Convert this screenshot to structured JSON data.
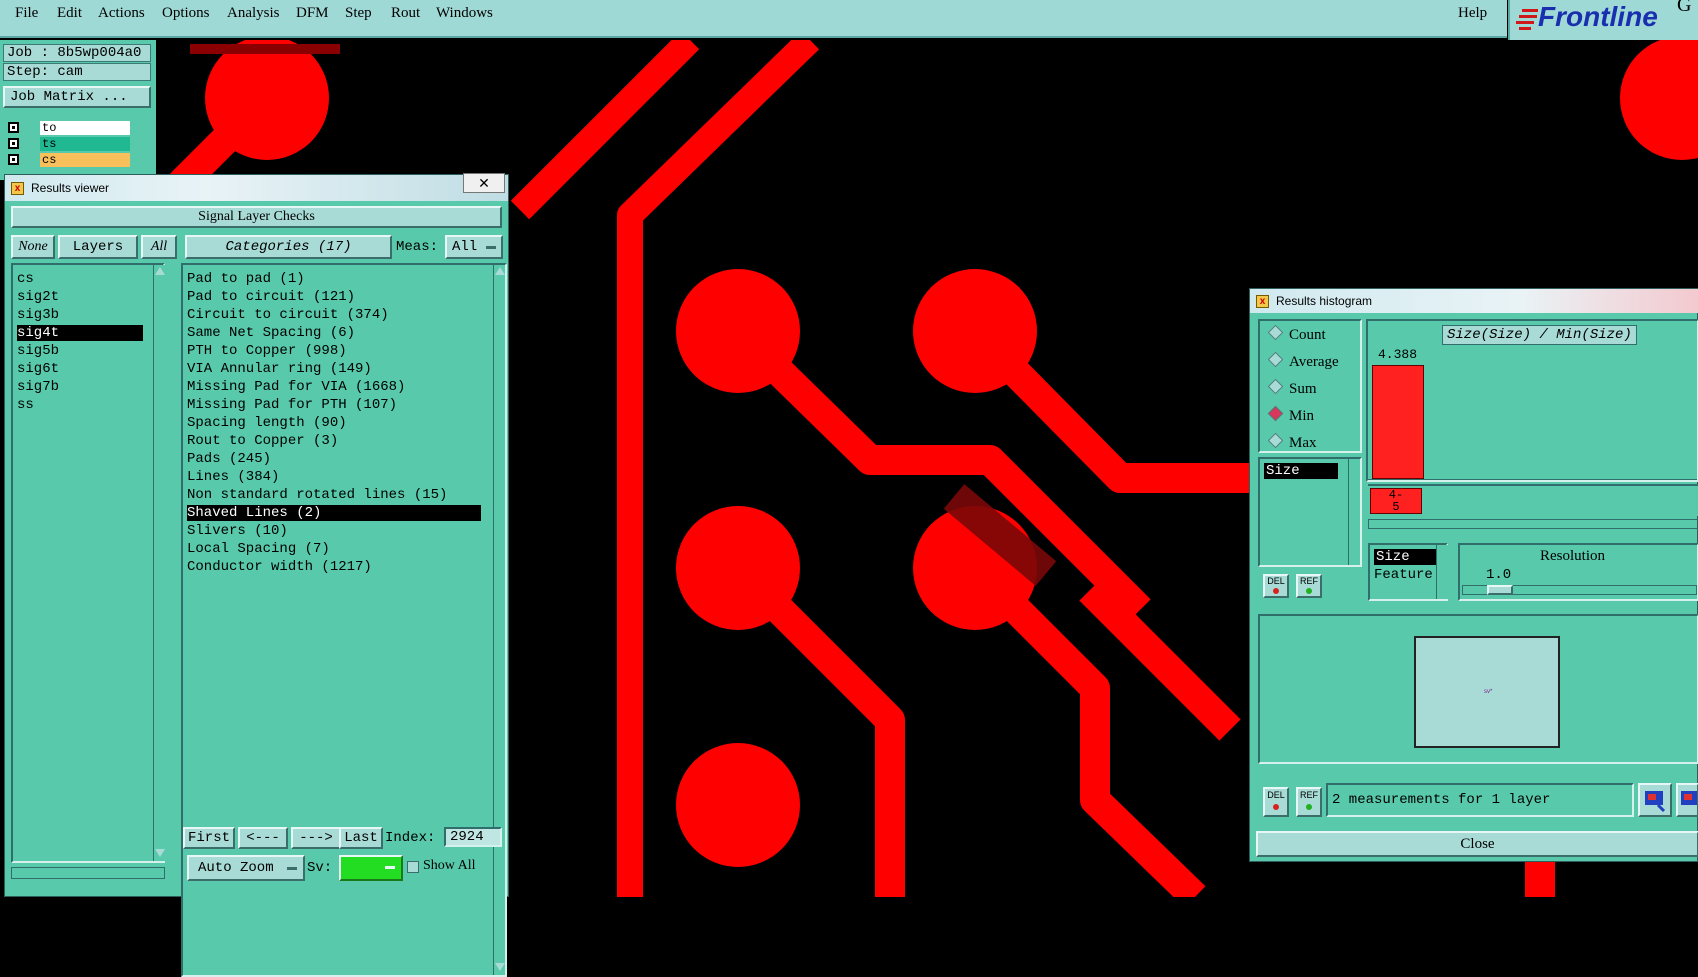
{
  "menubar": {
    "items": [
      "File",
      "Edit",
      "Actions",
      "Options",
      "Analysis",
      "DFM",
      "Step",
      "Rout",
      "Windows"
    ],
    "help": "Help"
  },
  "logo": {
    "text": "Frontline",
    "extra": "G"
  },
  "job_panel": {
    "job": "Job : 8b5wp004a0",
    "step": "Step: cam",
    "job_matrix_button": "Job Matrix ...",
    "layers": [
      {
        "name": "to",
        "color": "#ffffff"
      },
      {
        "name": "ts",
        "color": "#20b890"
      },
      {
        "name": "cs",
        "color": "#f7c05a"
      }
    ]
  },
  "results_viewer": {
    "title": "Results viewer",
    "header": "Signal Layer Checks",
    "none_btn": "None",
    "layers_btn": "Layers",
    "all_btn": "All",
    "categories_btn": "Categories (17)",
    "meas_label": "Meas:",
    "meas_value": "All",
    "layers": [
      "cs",
      "sig2t",
      "sig3b",
      "sig4t",
      "sig5b",
      "sig6t",
      "sig7b",
      "ss"
    ],
    "selected_layer": "sig4t",
    "categories": [
      "Pad to pad (1)",
      "Pad to circuit (121)",
      "Circuit to circuit (374)",
      "Same Net Spacing (6)",
      "PTH to Copper (998)",
      "VIA Annular ring (149)",
      "Missing Pad for VIA (1668)",
      "Missing Pad for PTH (107)",
      "Spacing length (90)",
      "Rout to Copper (3)",
      "Pads (245)",
      "Lines (384)",
      "Non standard rotated lines (15)",
      "Shaved Lines (2)",
      "Slivers (10)",
      "Local Spacing (7)",
      "Conductor width (1217)"
    ],
    "selected_category": "Shaved Lines (2)",
    "nav": {
      "first": "First",
      "prev": "<---",
      "next": "--->",
      "last": "Last",
      "index_label": "Index:",
      "index_value": "2924"
    },
    "auto_zoom": "Auto Zoom",
    "sv_label": "Sv:",
    "show_all": "Show All",
    "sv_color": "#22dd22"
  },
  "histogram": {
    "title": "Results histogram",
    "modes": [
      "Count",
      "Average",
      "Sum",
      "Min",
      "Max"
    ],
    "selected_mode": "Min",
    "list_item": "Size",
    "chart_title": "Size(Size) / Min(Size)",
    "bar_value": "4.388",
    "bar_value_num": 4.388,
    "bin_label_1": "4-",
    "bin_label_2": "5",
    "feature_items": [
      "Size",
      "Feature"
    ],
    "selected_feature": "Size",
    "resolution_label": "Resolution",
    "resolution_value": "1.0",
    "del": "DEL",
    "ref": "REF",
    "status": "2 measurements for 1 layer",
    "close": "Close",
    "preview_label": "sv*",
    "bar_color": "#ff2020"
  },
  "colors": {
    "copper": "#ff0000",
    "bg": "#000000",
    "panel": "#58c9aa",
    "menubar": "#9fd9d6"
  }
}
